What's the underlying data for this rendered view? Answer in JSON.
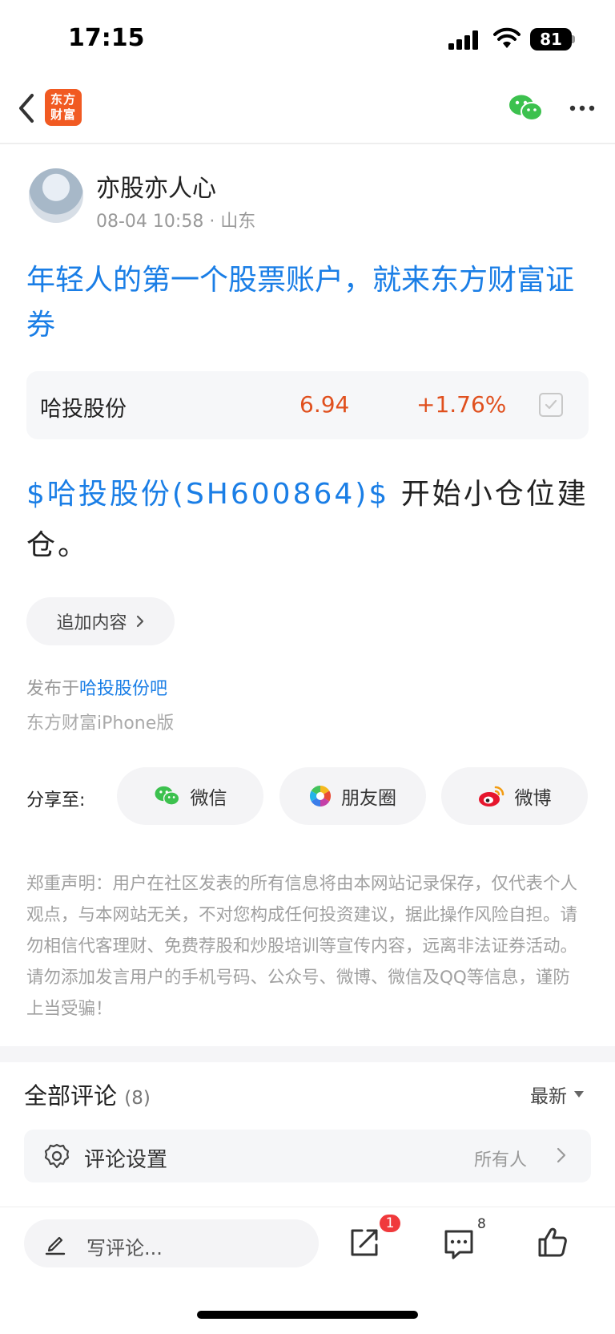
{
  "status_bar": {
    "time": "17:15",
    "battery": "81"
  },
  "nav": {
    "logo_text": "东方财富"
  },
  "author": {
    "name": "亦股亦人心",
    "meta": "08-04 10:58 · 山东"
  },
  "post": {
    "title": "年轻人的第一个股票账户，就来东方财富证券",
    "stock": {
      "name": "哈投股份",
      "price": "6.94",
      "change": "+1.76%"
    },
    "body_tag": "$哈投股份(SH600864)$",
    "body_text": " 开始小仓位建仓。",
    "add_content_label": "追加内容",
    "published_prefix": "发布于",
    "published_bar": "哈投股份吧",
    "source": "东方财富iPhone版"
  },
  "share": {
    "label": "分享至:",
    "targets": [
      {
        "label": "微信",
        "icon": "wechat-icon"
      },
      {
        "label": "朋友圈",
        "icon": "moments-icon"
      },
      {
        "label": "微博",
        "icon": "weibo-icon"
      }
    ]
  },
  "disclaimer": "郑重声明：用户在社区发表的所有信息将由本网站记录保存，仅代表个人观点，与本网站无关，不对您构成任何投资建议，据此操作风险自担。请勿相信代客理财、免费荐股和炒股培训等宣传内容，远离非法证券活动。请勿添加发言用户的手机号码、公众号、微博、微信及QQ等信息，谨防上当受骗！",
  "comments": {
    "title": "全部评论",
    "count": "(8)",
    "sort": "最新",
    "settings_label": "评论设置",
    "settings_value": "所有人"
  },
  "bottom_bar": {
    "write_placeholder": "写评论...",
    "share_badge": "1",
    "comment_count": "8"
  },
  "colors": {
    "link_blue": "#1a7ee6",
    "price_red": "#e0501e",
    "brand_orange": "#f15a22",
    "wechat_green": "#3cc14e"
  }
}
